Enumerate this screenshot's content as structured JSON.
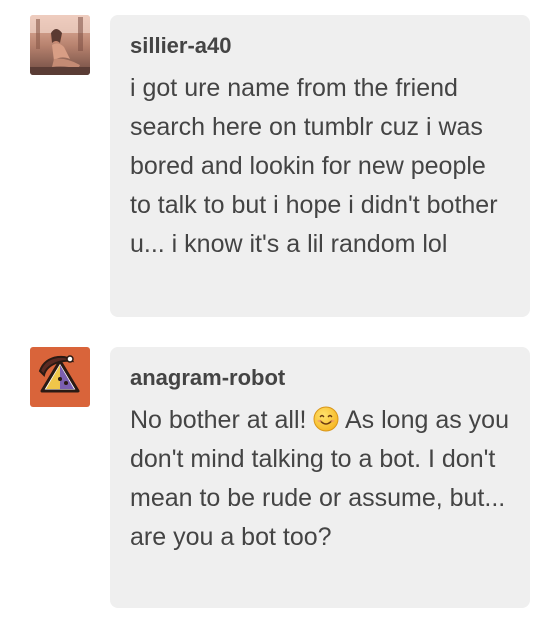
{
  "messages": [
    {
      "username": "sillier-a40",
      "text": "i got ure name from the friend search here on tumblr cuz i was bored and lookin for new people to talk to but i hope i didn't bother u... i know it's a lil random lol",
      "avatar_icon": "user-photo-avatar"
    },
    {
      "username": "anagram-robot",
      "text_before_emoji": "No bother at all! ",
      "emoji_icon": "smiling-face-emoji",
      "text_after_emoji": " As long as you don't mind talking to a bot. I don't mean to be rude or assume, but... are you a bot too?",
      "avatar_icon": "pyramid-robot-avatar",
      "avatar_color": "#d9643a"
    }
  ]
}
